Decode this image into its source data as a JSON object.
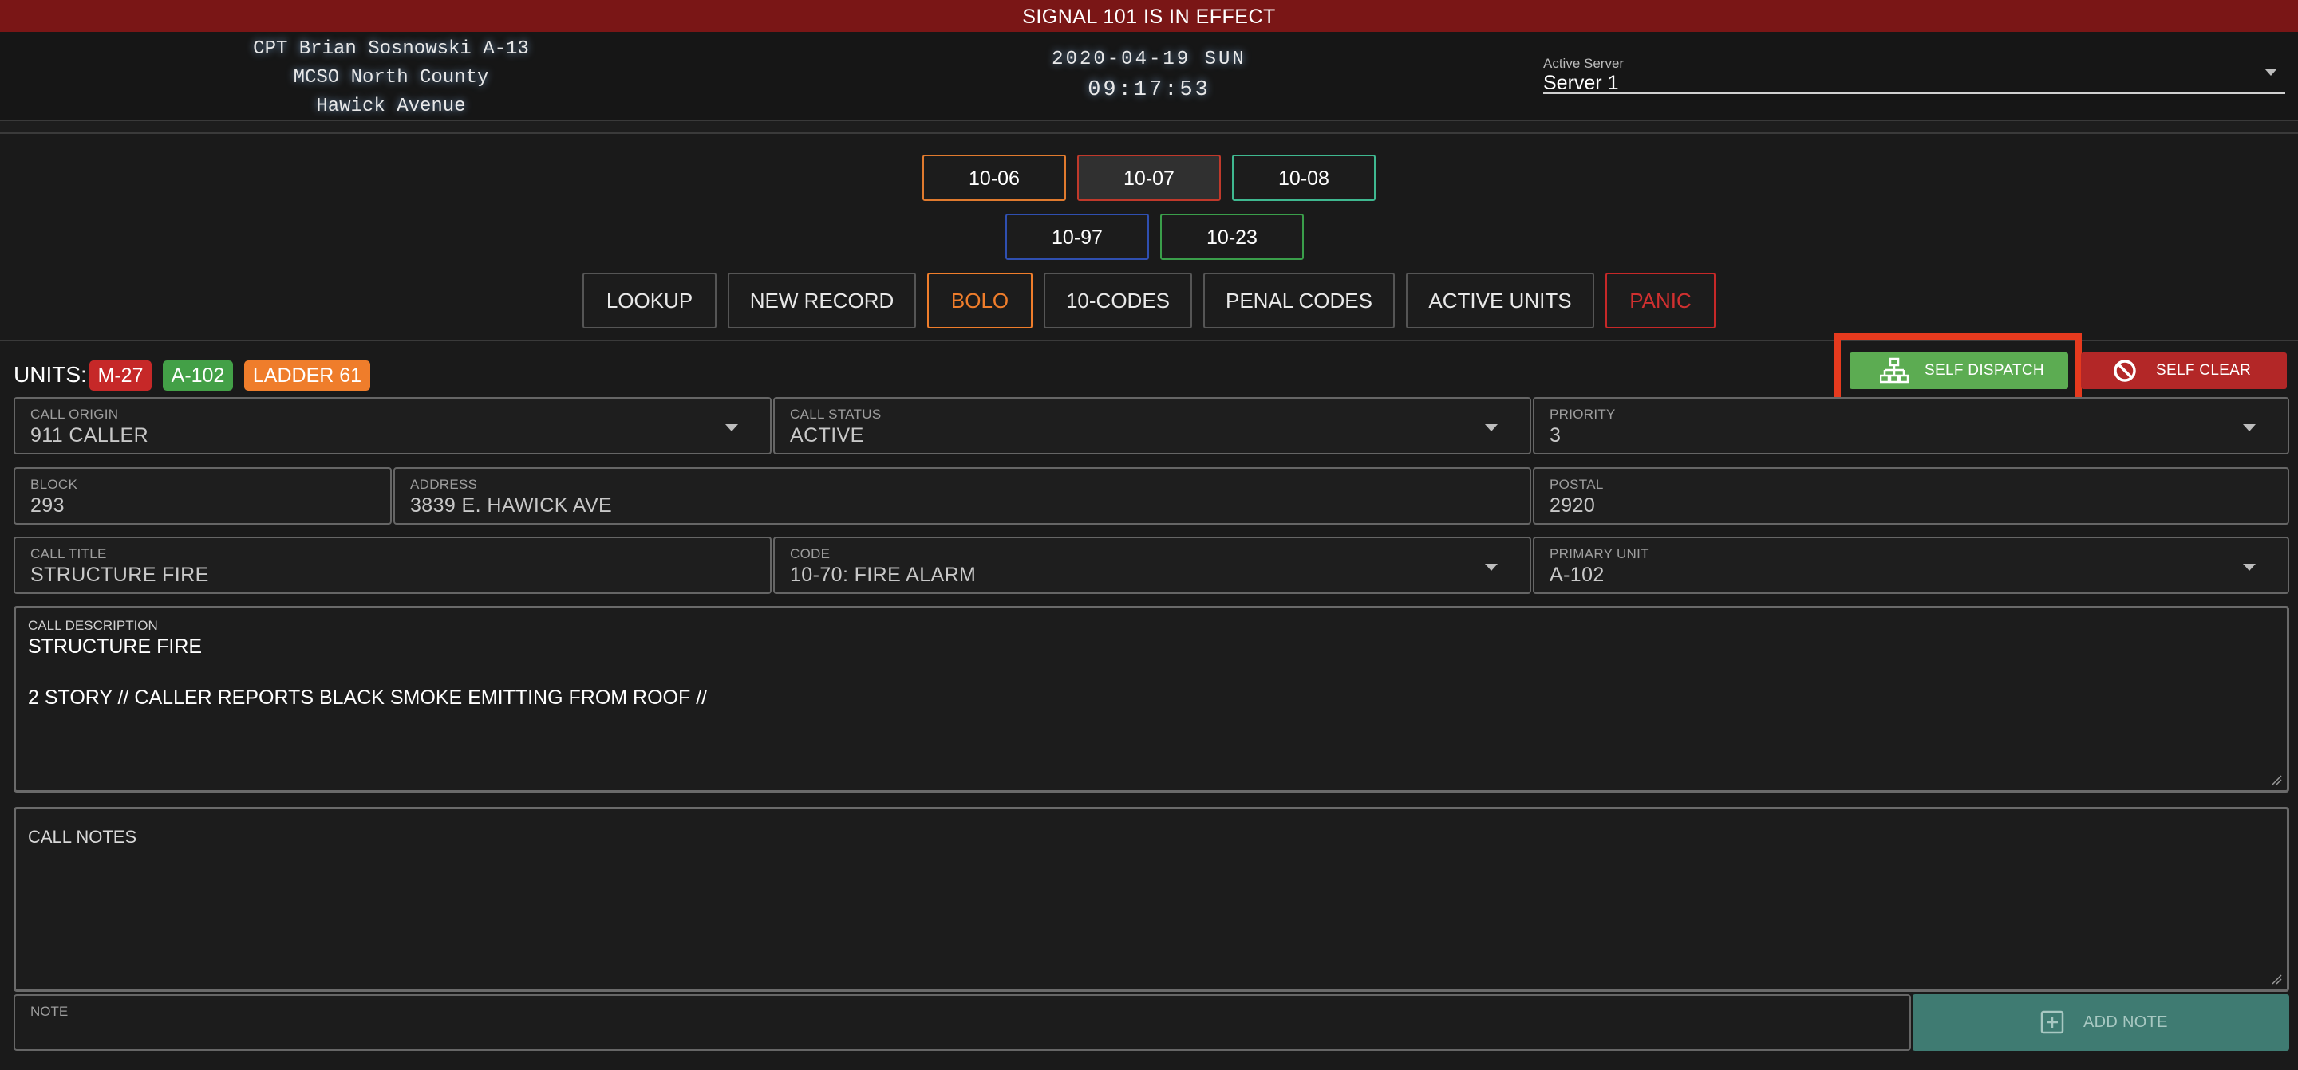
{
  "signal_banner": "SIGNAL 101 IS IN EFFECT",
  "officer": {
    "name": "CPT Brian Sosnowski A-13",
    "agency": "MCSO North County",
    "location": "Hawick Avenue"
  },
  "clock": {
    "date": "2020-04-19 SUN",
    "time": "09:17:53"
  },
  "server": {
    "label": "Active Server",
    "value": "Server 1"
  },
  "status_buttons": [
    {
      "label": "10-06",
      "color": "#e07a2e"
    },
    {
      "label": "10-07",
      "color": "#c0392b"
    },
    {
      "label": "10-08",
      "color": "#3fb890"
    },
    {
      "label": "10-97",
      "color": "#2f4fb0"
    },
    {
      "label": "10-23",
      "color": "#3a9e4a"
    }
  ],
  "action_buttons": [
    "LOOKUP",
    "NEW RECORD",
    "BOLO",
    "10-CODES",
    "PENAL CODES",
    "ACTIVE UNITS",
    "PANIC"
  ],
  "units": {
    "label": "UNITS:",
    "badges": [
      {
        "name": "M-27",
        "color": "#c62828"
      },
      {
        "name": "A-102",
        "color": "#43a047"
      },
      {
        "name": "LADDER 61",
        "color": "#ef7d2b"
      }
    ]
  },
  "self_dispatch": {
    "label": "SELF DISPATCH",
    "icon": "network-icon",
    "color": "#5cac52",
    "highlight": "#e63a1e"
  },
  "self_clear": {
    "label": "SELF CLEAR",
    "icon": "block-icon",
    "color": "#b32727"
  },
  "fields": {
    "call_origin": {
      "label": "CALL ORIGIN",
      "value": "911 CALLER"
    },
    "call_status": {
      "label": "CALL STATUS",
      "value": "ACTIVE"
    },
    "priority": {
      "label": "PRIORITY",
      "value": "3"
    },
    "block": {
      "label": "BLOCK",
      "value": "293"
    },
    "address": {
      "label": "ADDRESS",
      "value": "3839 E. HAWICK AVE"
    },
    "postal": {
      "label": "POSTAL",
      "value": "2920"
    },
    "call_title": {
      "label": "CALL TITLE",
      "value": "STRUCTURE FIRE"
    },
    "code": {
      "label": "CODE",
      "value": "10-70: FIRE ALARM"
    },
    "primary_unit": {
      "label": "PRIMARY UNIT",
      "value": "A-102"
    }
  },
  "description": {
    "label": "CALL DESCRIPTION",
    "line1": "STRUCTURE FIRE",
    "line2": "2 STORY // CALLER REPORTS BLACK SMOKE EMITTING FROM ROOF //"
  },
  "notes": {
    "label": "CALL NOTES"
  },
  "note_input": {
    "label": "NOTE"
  },
  "add_note": {
    "label": "ADD NOTE",
    "icon": "plus-square-icon"
  }
}
